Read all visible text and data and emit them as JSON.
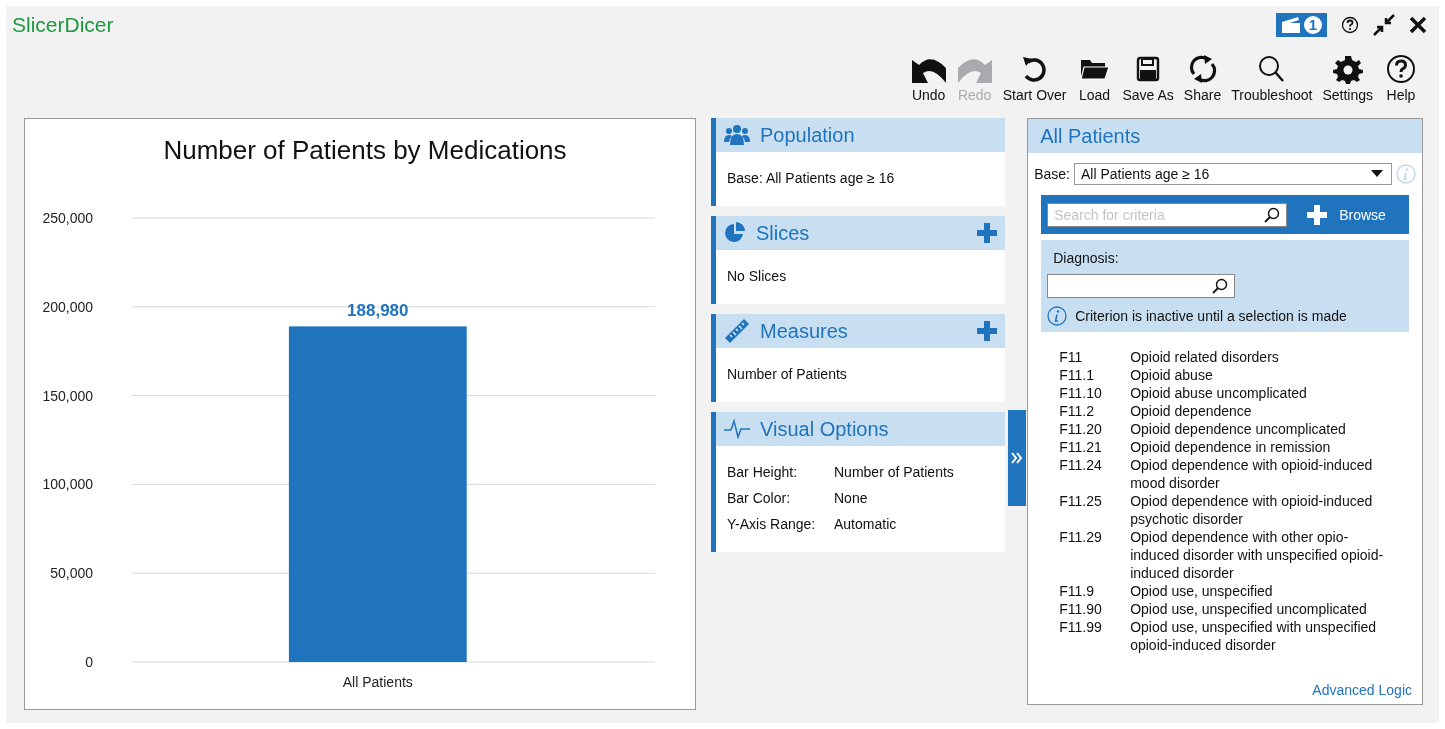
{
  "app": {
    "title": "SlicerDicer",
    "badge": "1"
  },
  "toolbar": [
    {
      "kind": "undo",
      "label": "Undo",
      "disabled": false
    },
    {
      "kind": "redo",
      "label": "Redo",
      "disabled": true
    },
    {
      "kind": "start-over",
      "label": "Start Over",
      "disabled": false
    },
    {
      "kind": "load",
      "label": "Load",
      "disabled": false
    },
    {
      "kind": "save",
      "label": "Save As",
      "disabled": false
    },
    {
      "kind": "share",
      "label": "Share",
      "disabled": false
    },
    {
      "kind": "troubleshoot",
      "label": "Troubleshoot",
      "disabled": false
    },
    {
      "kind": "settings",
      "label": "Settings",
      "disabled": false
    },
    {
      "kind": "help",
      "label": "Help",
      "disabled": false
    }
  ],
  "chart": {
    "chart_data": {
      "type": "bar",
      "title": "Number of Patients by Medications",
      "categories": [
        "All Patients"
      ],
      "values": [
        188980
      ],
      "ylim": [
        0,
        250000
      ],
      "grid": true,
      "yticks": [
        {
          "value": 0,
          "label": "0"
        },
        {
          "value": 50000,
          "label": "50,000"
        },
        {
          "value": 100000,
          "label": "100,000"
        },
        {
          "value": 150000,
          "label": "150,000"
        },
        {
          "value": 200000,
          "label": "200,000"
        },
        {
          "value": 250000,
          "label": "250,000"
        }
      ],
      "value_labels": [
        "188,980"
      ]
    }
  },
  "sections": [
    {
      "kind": "population",
      "title": "Population",
      "addable": false,
      "text": "Base: All Patients age ≥ 16"
    },
    {
      "kind": "slices",
      "title": "Slices",
      "addable": true,
      "text": "No Slices"
    },
    {
      "kind": "measures",
      "title": "Measures",
      "addable": true,
      "text": "Number of Patients"
    },
    {
      "kind": "visual",
      "title": "Visual Options",
      "addable": false,
      "options": [
        {
          "label": "Bar Height:",
          "value": "Number of Patients"
        },
        {
          "label": "Bar Color:",
          "value": "None"
        },
        {
          "label": "Y-Axis Range:",
          "value": "Automatic"
        }
      ]
    }
  ],
  "criteria_panel": {
    "title": "All Patients",
    "base_label": "Base:",
    "base_value": "All Patients age ≥ 16",
    "search": {
      "placeholder": "Search for criteria"
    },
    "browse": "Browse",
    "diagnosis_label": "Diagnosis:",
    "notice": "Criterion is inactive until a selection is made",
    "items": [
      {
        "code": "F11",
        "description": "Opioid related disorders"
      },
      {
        "code": "F11.1",
        "description": "Opioid abuse"
      },
      {
        "code": "F11.10",
        "description": "Opioid abuse uncomplicated"
      },
      {
        "code": "F11.2",
        "description": "Opioid dependence"
      },
      {
        "code": "F11.20",
        "description": "Opioid dependence uncomplicated"
      },
      {
        "code": "F11.21",
        "description": "Opioid dependence in remission"
      },
      {
        "code": "F11.24",
        "description": "Opiod dependence with opioid-induced mood disorder"
      },
      {
        "code": "F11.25",
        "description": "Opiod dependence with opioid-induced psychotic disorder"
      },
      {
        "code": "F11.29",
        "description": "Opiod dependence with other opio-induced disorder with unspecified opioid-induced disorder"
      },
      {
        "code": "F11.9",
        "description": "Opiod use, unspecified"
      },
      {
        "code": "F11.90",
        "description": "Opiod use, unspecified uncomplicated"
      },
      {
        "code": "F11.99",
        "description": "Opiod use, unspecified with unspecified opioid-induced disorder"
      }
    ],
    "advanced_link": "Advanced Logic"
  }
}
